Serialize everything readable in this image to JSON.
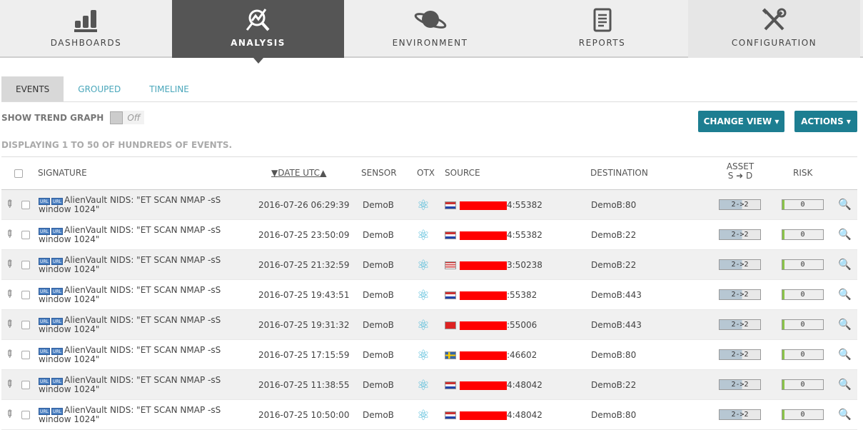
{
  "nav": [
    {
      "label": "DASHBOARDS",
      "icon": "bar-chart-icon"
    },
    {
      "label": "ANALYSIS",
      "icon": "magnifier-chart-icon",
      "active": true
    },
    {
      "label": "ENVIRONMENT",
      "icon": "planet-icon"
    },
    {
      "label": "REPORTS",
      "icon": "document-icon"
    },
    {
      "label": "CONFIGURATION",
      "icon": "tools-icon"
    }
  ],
  "subtabs": [
    "EVENTS",
    "GROUPED",
    "TIMELINE"
  ],
  "trend": {
    "label": "SHOW TREND GRAPH",
    "state": "Off"
  },
  "displaying": "DISPLAYING 1 TO 50 OF HUNDREDS OF EVENTS.",
  "buttons": {
    "change_view": "CHANGE VIEW ▾",
    "actions": "ACTIONS ▾"
  },
  "colors": {
    "accent": "#1d7e91",
    "active_tab": "#555555",
    "link": "#4aa7bb"
  },
  "columns": {
    "signature": "SIGNATURE",
    "date": "DATE UTC",
    "sensor": "SENSOR",
    "otx": "OTX",
    "source": "SOURCE",
    "destination": "DESTINATION",
    "asset": "ASSET",
    "asset_sub": "S ➜ D",
    "risk": "RISK"
  },
  "rows": [
    {
      "signature": "AlienVault NIDS: \"ET SCAN NMAP -sS window 1024\"",
      "date": "2016-07-26 06:29:39",
      "sensor": "DemoB",
      "flag": "nl",
      "source_suffix": "4:55382",
      "destination": "DemoB:80",
      "asset": "2->2",
      "risk": "0"
    },
    {
      "signature": "AlienVault NIDS: \"ET SCAN NMAP -sS window 1024\"",
      "date": "2016-07-25 23:50:09",
      "sensor": "DemoB",
      "flag": "nl",
      "source_suffix": "4:55382",
      "destination": "DemoB:22",
      "asset": "2->2",
      "risk": "0"
    },
    {
      "signature": "AlienVault NIDS: \"ET SCAN NMAP -sS window 1024\"",
      "date": "2016-07-25 21:32:59",
      "sensor": "DemoB",
      "flag": "us",
      "source_suffix": "3:50238",
      "destination": "DemoB:22",
      "asset": "2->2",
      "risk": "0"
    },
    {
      "signature": "AlienVault NIDS: \"ET SCAN NMAP -sS window 1024\"",
      "date": "2016-07-25 19:43:51",
      "sensor": "DemoB",
      "flag": "nl",
      "source_suffix": ":55382",
      "destination": "DemoB:443",
      "asset": "2->2",
      "risk": "0"
    },
    {
      "signature": "AlienVault NIDS: \"ET SCAN NMAP -sS window 1024\"",
      "date": "2016-07-25 19:31:32",
      "sensor": "DemoB",
      "flag": "cn",
      "source_suffix": ":55006",
      "destination": "DemoB:443",
      "asset": "2->2",
      "risk": "0"
    },
    {
      "signature": "AlienVault NIDS: \"ET SCAN NMAP -sS window 1024\"",
      "date": "2016-07-25 17:15:59",
      "sensor": "DemoB",
      "flag": "se",
      "source_suffix": ":46602",
      "destination": "DemoB:80",
      "asset": "2->2",
      "risk": "0"
    },
    {
      "signature": "AlienVault NIDS: \"ET SCAN NMAP -sS window 1024\"",
      "date": "2016-07-25 11:38:55",
      "sensor": "DemoB",
      "flag": "nl",
      "source_suffix": "4:48042",
      "destination": "DemoB:22",
      "asset": "2->2",
      "risk": "0"
    },
    {
      "signature": "AlienVault NIDS: \"ET SCAN NMAP -sS window 1024\"",
      "date": "2016-07-25 10:50:00",
      "sensor": "DemoB",
      "flag": "nl",
      "source_suffix": "4:48042",
      "destination": "DemoB:80",
      "asset": "2->2",
      "risk": "0"
    }
  ]
}
